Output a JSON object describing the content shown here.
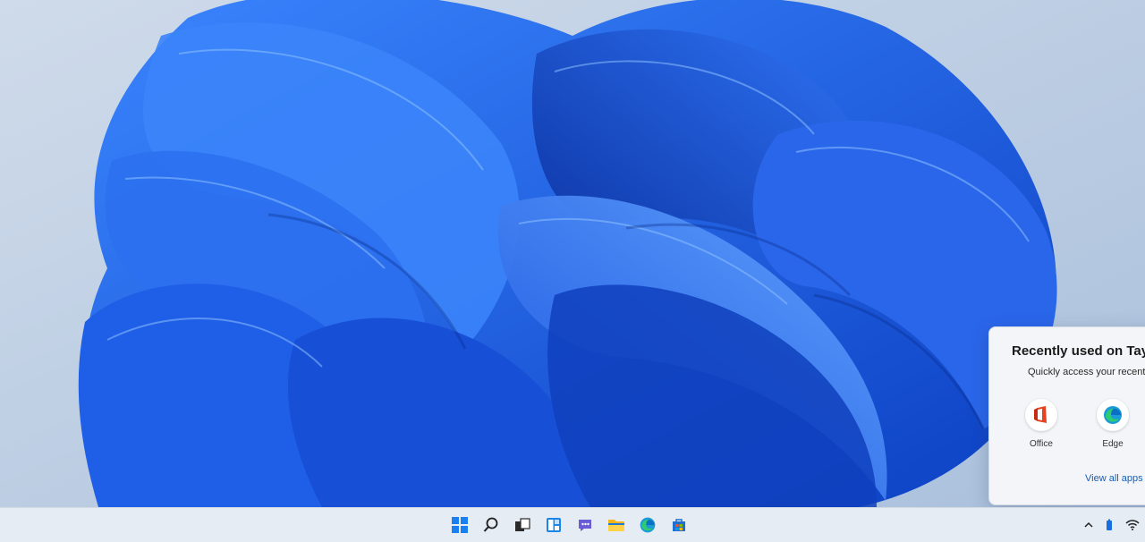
{
  "popup": {
    "title": "Recently used on Tay",
    "subtitle": "Quickly access your recentl",
    "apps": [
      {
        "label": "Office",
        "icon": "office-icon"
      },
      {
        "label": "Edge",
        "icon": "edge-icon"
      }
    ],
    "view_all": "View all apps"
  },
  "taskbar": {
    "icons": [
      "start-icon",
      "search-icon",
      "task-view-icon",
      "widgets-icon",
      "chat-icon",
      "file-explorer-icon",
      "edge-icon",
      "store-icon"
    ],
    "tray": [
      "chevron-up-icon",
      "battery-icon",
      "wifi-icon"
    ]
  },
  "colors": {
    "wallpaper_blue": "#1f5fe0",
    "desktop_bg": "#c3d2e4",
    "taskbar_bg": "#e6ecf3",
    "link": "#1460b8"
  }
}
